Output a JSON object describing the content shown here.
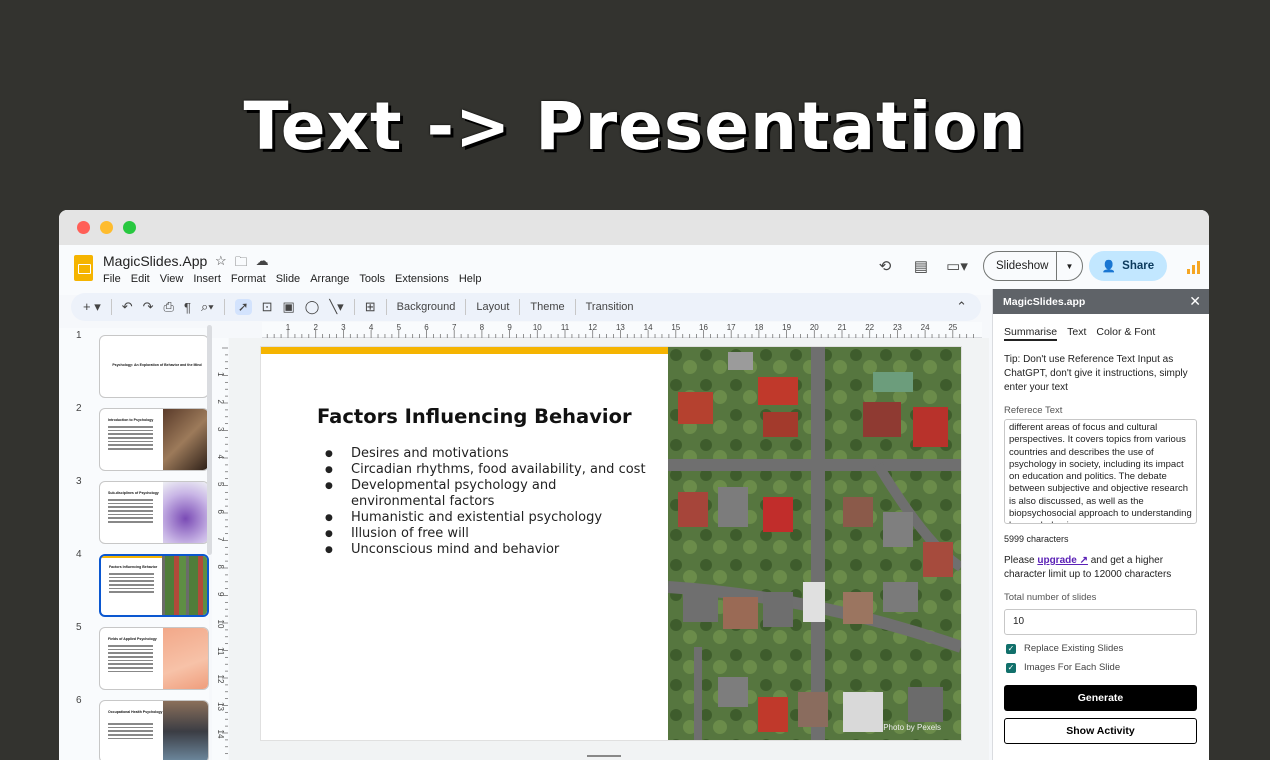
{
  "hero": {
    "title": "Text -> Presentation"
  },
  "app": {
    "doc_title": "MagicSlides.App",
    "menu": [
      "File",
      "Edit",
      "View",
      "Insert",
      "Format",
      "Slide",
      "Arrange",
      "Tools",
      "Extensions",
      "Help"
    ],
    "slideshow_label": "Slideshow",
    "share_label": "Share"
  },
  "toolbar": {
    "background": "Background",
    "layout": "Layout",
    "theme": "Theme",
    "transition": "Transition"
  },
  "thumbnails": [
    {
      "num": "1",
      "title": "Psychology: An Exploration of Behavior and the Mind"
    },
    {
      "num": "2",
      "title": "Introduction to Psychology"
    },
    {
      "num": "3",
      "title": "Sub-disciplines of Psychology"
    },
    {
      "num": "4",
      "title": "Factors Influencing Behavior"
    },
    {
      "num": "5",
      "title": "Fields of Applied Psychology"
    },
    {
      "num": "6",
      "title": "Occupational Health Psychology"
    }
  ],
  "ruler": {
    "h": [
      "1",
      "2",
      "3",
      "4",
      "5",
      "6",
      "7",
      "8",
      "9",
      "10",
      "11",
      "12",
      "13",
      "14",
      "15",
      "16",
      "17",
      "18",
      "19",
      "20",
      "21",
      "22",
      "23",
      "24",
      "25"
    ],
    "v": [
      "1",
      "2",
      "3",
      "4",
      "5",
      "6",
      "7",
      "8",
      "9",
      "10",
      "11",
      "12",
      "13",
      "14"
    ]
  },
  "slide": {
    "title": "Factors Influencing Behavior",
    "bullets": [
      "Desires and motivations",
      "Circadian rhythms, food availability, and cost",
      "Developmental psychology and environmental factors",
      "Humanistic and existential psychology",
      "Illusion of free will",
      "Unconscious mind and behavior"
    ],
    "photo_credit": "Photo by Pexels"
  },
  "panel": {
    "header": "MagicSlides.app",
    "tabs": [
      "Summarise",
      "Text",
      "Color & Font"
    ],
    "tip": "Tip: Don't use Reference Text Input as ChatGPT, don't give it instructions, simply enter your text",
    "ref_label": "Referece Text",
    "ref_text": "different areas of focus and cultural perspectives. It covers topics from various countries and describes the use of psychology in society, including its impact on education and politics. The debate between subjective and objective research is also discussed, as well as the biopsychosocial approach to understanding human behavior.",
    "char_count": "5999 characters",
    "upgrade_pre": "Please ",
    "upgrade_link": "upgrade ↗",
    "upgrade_post": " and get a higher character limit up to 12000 characters",
    "total_label": "Total number of slides",
    "total_value": "10",
    "replace_label": "Replace Existing Slides",
    "images_label": "Images For Each Slide",
    "generate_label": "Generate",
    "activity_label": "Show Activity"
  },
  "colors": {
    "accent": "#f5b400",
    "share_bg": "#c2e7ff",
    "checkbox": "#11706b"
  }
}
